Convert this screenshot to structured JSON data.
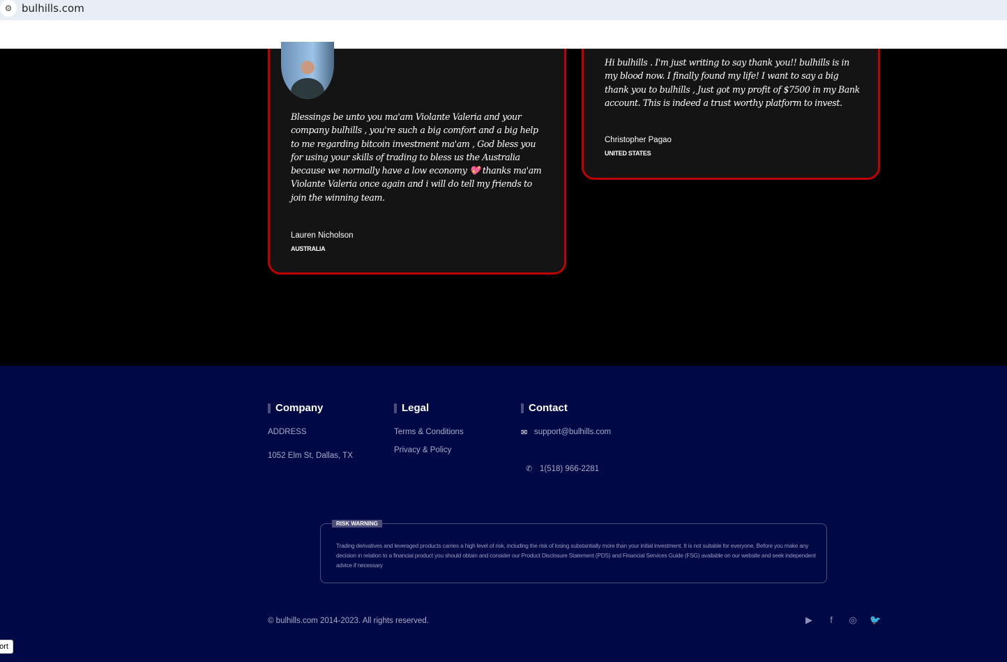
{
  "browser": {
    "url": "bulhills.com"
  },
  "testimonials": [
    {
      "quote": "Blessings be unto you ma'am Violante Valeria and your company bulhills , you're such a big comfort and a big help to me regarding bitcoin investment ma'am , God bless you for using your skills of trading to bless us the Australia because we normally have a low economy 💖 thanks ma'am Violante Valeria once again and i will do tell my friends to join the winning team.",
      "name": "Lauren Nicholson",
      "country": "AUSTRALIA"
    },
    {
      "quote": "Hi bulhills . I'm just writing to say thank you!! bulhills is in my blood now. I finally found my life! I want to say a big thank you to bulhills , Just got my profit of $7500 in my Bank account. This is indeed a trust worthy platform to invest.",
      "name": "Christopher Pagao",
      "country": "UNITED STATES"
    }
  ],
  "footer": {
    "company": {
      "heading": "Company",
      "address_label": "ADDRESS",
      "address": "1052 Elm St, Dallas, TX"
    },
    "legal": {
      "heading": "Legal",
      "terms": "Terms & Conditions",
      "privacy": "Privacy & Policy"
    },
    "contact": {
      "heading": "Contact",
      "email": "support@bulhills.com",
      "phone": "1(518) 966-2281"
    },
    "risk": {
      "label": "RISK WARNING",
      "text": "Trading derivatives and leveraged products carries a high level of risk, including the risk of losing substantially more than your initial investment. It is not suitable for everyone. Before you make any decision in relation to a financial product you should obtain and consider our Product Disclosure Statement (PDS) and Financial Services Guide (FSG) available on our website and seek independent advice if necessary"
    },
    "copyright": "© bulhills.com 2014-2023. All rights reserved."
  },
  "support_button": "port"
}
